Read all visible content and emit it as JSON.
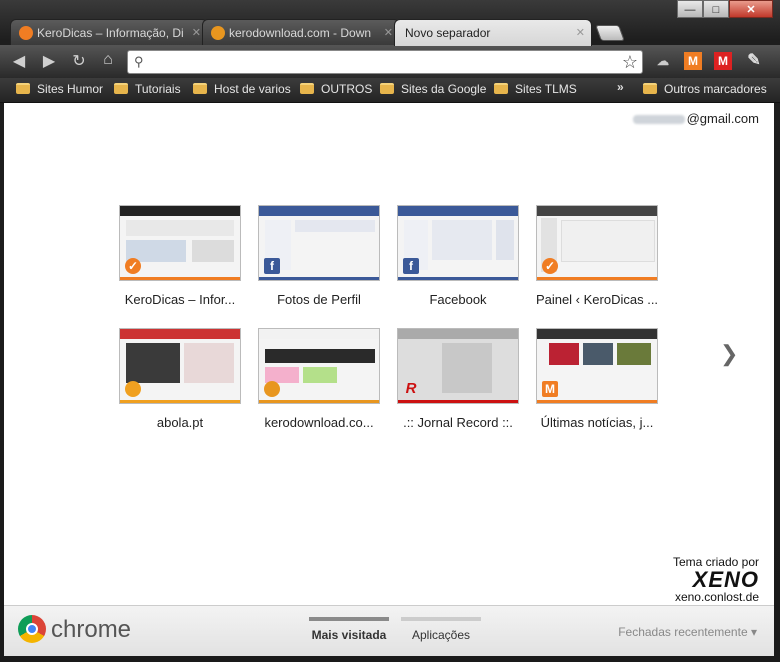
{
  "window": {
    "minimize": "—",
    "maximize": "□",
    "close": "✕"
  },
  "tabs": [
    {
      "title": "KeroDicas – Informação, Di",
      "icon": "kerodicas-check-icon",
      "color": "#f07d23"
    },
    {
      "title": "kerodownload.com - Down",
      "icon": "kerodownload-icon",
      "color": "#e8961f"
    },
    {
      "title": "Novo separador",
      "icon": "",
      "color": ""
    }
  ],
  "toolbar": {
    "omnibox_value": ""
  },
  "bookmarks": [
    "Sites Humor",
    "Tutoriais",
    "Host de varios",
    "OUTROS",
    "Sites da Google",
    "Sites TLMS"
  ],
  "other_bookmarks": "Outros marcadores",
  "account": {
    "suffix": "@gmail.com"
  },
  "tiles": [
    {
      "title": "KeroDicas – Infor...",
      "icon": "kerodicas-check-icon",
      "accent": "#f07d23"
    },
    {
      "title": "Fotos de Perfil",
      "icon": "facebook-icon",
      "accent": "#3b5998"
    },
    {
      "title": "Facebook",
      "icon": "facebook-icon",
      "accent": "#3b5998"
    },
    {
      "title": "Painel ‹ KeroDicas ...",
      "icon": "kerodicas-check-icon",
      "accent": "#f07d23"
    },
    {
      "title": "abola.pt",
      "icon": "abola-ball-icon",
      "accent": "#f0a020"
    },
    {
      "title": "kerodownload.co...",
      "icon": "kerodownload-icon",
      "accent": "#e8961f"
    },
    {
      "title": ".:: Jornal Record ::.",
      "icon": "record-r-icon",
      "accent": "#cc1111"
    },
    {
      "title": "Últimas notícias, j...",
      "icon": "maisfutebol-m-icon",
      "accent": "#f07d23"
    }
  ],
  "theme_credit": {
    "line1": "Tema criado por",
    "brand": "XENO",
    "site": "xeno.conlost.de"
  },
  "footer": {
    "brand": "chrome",
    "tab_most_visited": "Mais visitada",
    "tab_apps": "Aplicações",
    "recently_closed": "Fechadas recentemente"
  }
}
